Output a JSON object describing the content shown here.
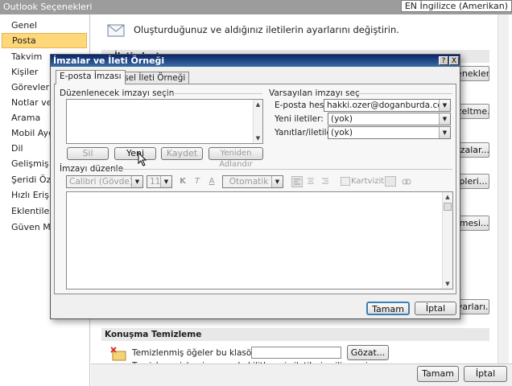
{
  "outlook": {
    "title": "Outlook Seçenekleri",
    "language": "EN İngilizce (Amerikan)",
    "nav": [
      "Genel",
      "Posta",
      "Takvim",
      "Kişiler",
      "Görevler",
      "Notlar ve Gün",
      "Arama",
      "Mobil Aygıt",
      "Dil",
      "Gelişmiş",
      "Şeridi Özelleş",
      "Hızlı Erişim Ar",
      "Eklentiler",
      "Güven Merke"
    ],
    "selected_nav_index": 1,
    "intro": "Oluşturduğunuz ve aldığınız iletilerin ayarlarını değiştirin.",
    "section_partial": "İleti oluştur",
    "right_buttons": [
      "çenekler...",
      "ezeltme...",
      "mzalar...",
      "Tipleri...",
      "ölmesi...",
      "ayarları..."
    ],
    "conv_section": "Konuşma Temizleme",
    "conv_label": "Temizlenmiş öğeler bu klasöre gidecek:",
    "conv_partial_text": "Temizleme işlemi sırasında kilitlenmiş iletilerin silinmesi...",
    "browse": "Gözat...",
    "ok": "Tamam",
    "cancel": "İptal"
  },
  "dialog": {
    "title": "İmzalar ve İleti Örneği",
    "help": "?",
    "close": "X",
    "tabs": [
      "E-posta İmzası",
      "Kişisel İleti Örneği"
    ],
    "edit_label": "Düzenlenecek imzayı seçin",
    "buttons": {
      "delete": "Sil",
      "new": "Yeni",
      "save": "Kaydet",
      "rename": "Yeniden Adlandır"
    },
    "default_label": "Varsayılan imzayı seç",
    "email_account_label": "E-posta hesabı:",
    "email_account": "hakki.ozer@doganburda.com",
    "new_messages_label": "Yeni iletiler:",
    "new_messages": "(yok)",
    "replies_label": "Yanıtlar/iletilenler:",
    "replies": "(yok)",
    "editor_label": "İmzayı düzenle",
    "font": "Calibri (Gövde)",
    "size": "11",
    "bold": "K",
    "italic": "T",
    "underline": "A",
    "color": "Otomatik",
    "business_card": "Kartvizit",
    "ok": "Tamam",
    "cancel": "İptal"
  }
}
